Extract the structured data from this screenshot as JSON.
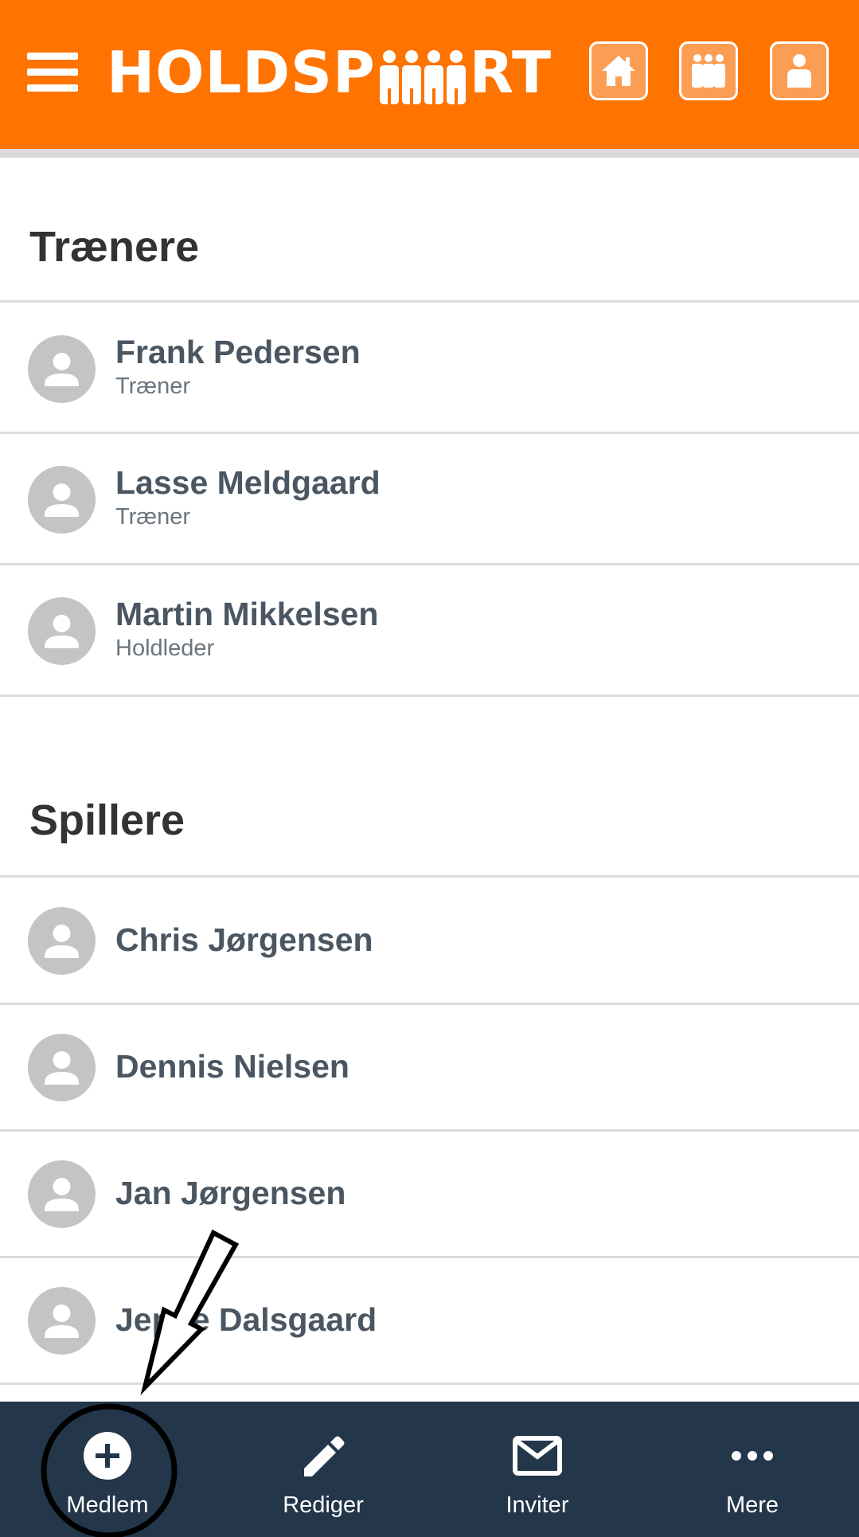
{
  "header": {
    "logo_left": "HOLDSP",
    "logo_right": "RT",
    "icons": [
      "home-icon",
      "team-icon",
      "profile-icon"
    ]
  },
  "sections": {
    "trainers": {
      "title": "Trænere",
      "members": [
        {
          "name": "Frank Pedersen",
          "role": "Træner"
        },
        {
          "name": "Lasse Meldgaard",
          "role": "Træner"
        },
        {
          "name": "Martin Mikkelsen",
          "role": "Holdleder"
        }
      ]
    },
    "players": {
      "title": "Spillere",
      "members": [
        {
          "name": "Chris Jørgensen"
        },
        {
          "name": "Dennis Nielsen"
        },
        {
          "name": "Jan Jørgensen"
        },
        {
          "name": "Jeppe Dalsgaard"
        }
      ]
    }
  },
  "bottom_nav": {
    "items": [
      {
        "label": "Medlem",
        "icon": "add-circle-icon"
      },
      {
        "label": "Rediger",
        "icon": "pencil-icon"
      },
      {
        "label": "Inviter",
        "icon": "envelope-icon"
      },
      {
        "label": "Mere",
        "icon": "more-dots-icon"
      }
    ]
  },
  "colors": {
    "brand_orange": "#ff7300",
    "nav_dark": "#23364a",
    "avatar_gray": "#c4c4c4",
    "text_dark": "#4a5661"
  }
}
